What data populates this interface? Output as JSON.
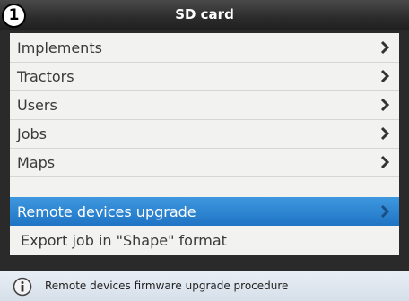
{
  "header": {
    "badge": "1",
    "title": "SD card"
  },
  "menu": {
    "items": [
      {
        "label": "Implements",
        "has_chevron": true
      },
      {
        "label": "Tractors",
        "has_chevron": true
      },
      {
        "label": "Users",
        "has_chevron": true
      },
      {
        "label": "Jobs",
        "has_chevron": true
      },
      {
        "label": "Maps",
        "has_chevron": true
      },
      {
        "label": "Remote devices upgrade",
        "has_chevron": true,
        "selected": true
      },
      {
        "label": "Export job in \"Shape\" format",
        "has_chevron": false
      }
    ]
  },
  "info_bar": {
    "icon": "info-icon",
    "text": "Remote devices firmware upgrade procedure"
  },
  "colors": {
    "selected": "#2a86d6",
    "titlebar": "#2b2b2b",
    "panel": "#f2f2f0"
  }
}
